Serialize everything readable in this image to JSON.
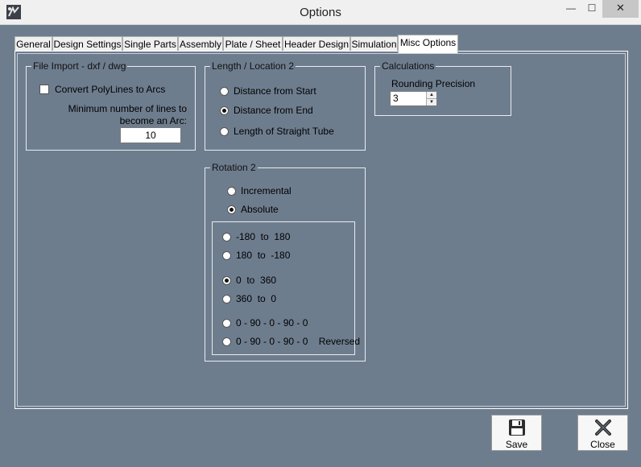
{
  "window": {
    "title": "Options",
    "minimize_glyph": "—",
    "maximize_glyph": "☐",
    "close_glyph": "✕",
    "app_icon": "app-logo-icon"
  },
  "tabs": [
    {
      "label": "General"
    },
    {
      "label": "Design Settings"
    },
    {
      "label": "Single Parts"
    },
    {
      "label": "Assembly"
    },
    {
      "label": "Plate / Sheet"
    },
    {
      "label": "Header Design"
    },
    {
      "label": "Simulation"
    },
    {
      "label": "Misc Options"
    }
  ],
  "active_tab": "Misc Options",
  "file_import": {
    "title": "File Import - dxf / dwg",
    "convert_label": "Convert PolyLines to Arcs",
    "convert_checked": false,
    "min_lines_label_1": "Minimum number of lines to",
    "min_lines_label_2": "become an Arc:",
    "min_lines_value": "10"
  },
  "length_location": {
    "title": "Length / Location 2",
    "options": [
      "Distance from Start",
      "Distance from End",
      "Length of Straight Tube"
    ],
    "selected": "Distance from End"
  },
  "calculations": {
    "title": "Calculations",
    "rounding_label": "Rounding Precision",
    "rounding_value": "3"
  },
  "rotation": {
    "title": "Rotation 2",
    "modes": [
      "Incremental",
      "Absolute"
    ],
    "selected_mode": "Absolute",
    "ranges": [
      "-180  to  180",
      "180  to  -180",
      "0  to  360",
      "360  to  0",
      "0 - 90 - 0 - 90 - 0",
      "0 - 90 - 0 - 90 - 0    Reversed"
    ],
    "selected_range": "0  to  360"
  },
  "buttons": {
    "save_label": "Save",
    "close_label": "Close"
  },
  "colors": {
    "background": "#6e7d8e",
    "tab_active": "#ffffff",
    "border": "#ffffff"
  }
}
